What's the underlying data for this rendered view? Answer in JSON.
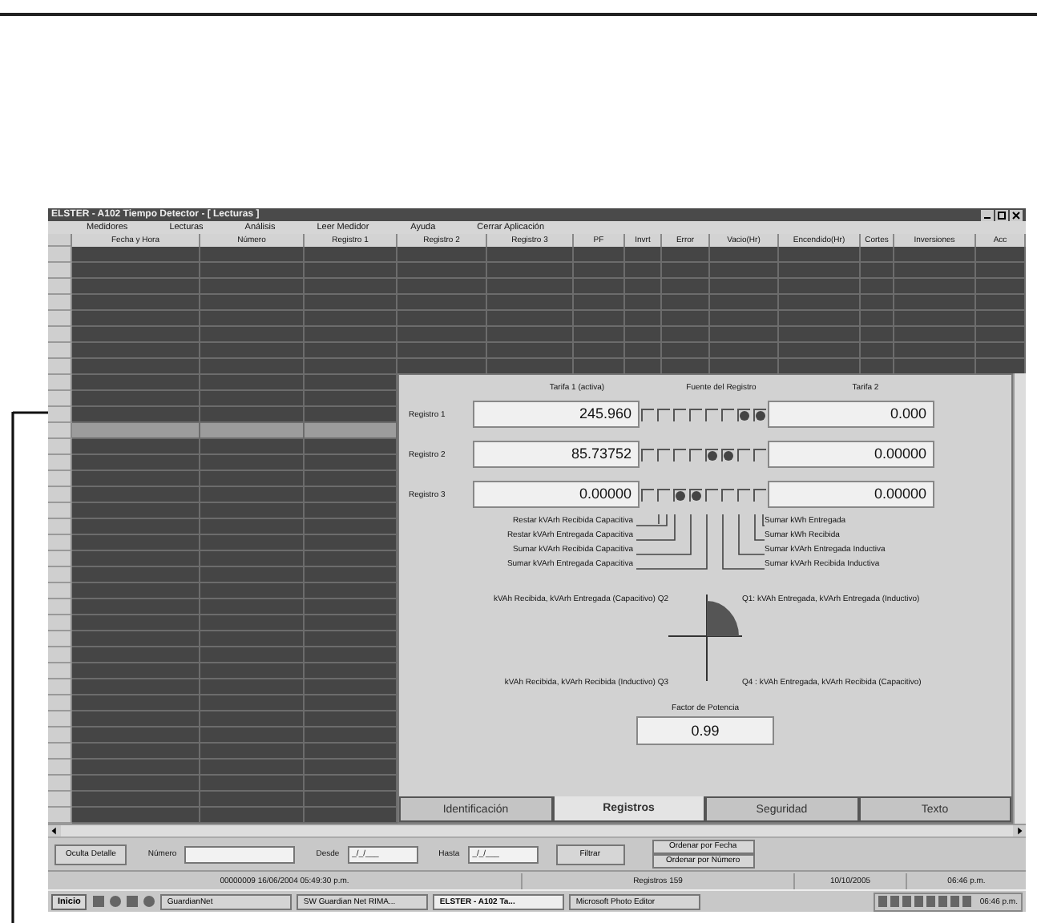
{
  "window": {
    "title": "ELSTER - A102 Tiempo Detector - [ Lecturas ]"
  },
  "menu": [
    "Medidores",
    "Lecturas",
    "Análisis",
    "Leer Medidor",
    "Ayuda",
    "Cerrar Aplicación"
  ],
  "table": {
    "columns": [
      "Fecha y Hora",
      "Número",
      "Registro 1",
      "Registro 2",
      "Registro 3",
      "PF",
      "Invrt",
      "Error",
      "Vacio(Hr)",
      "Encendido(Hr)",
      "Cortes",
      "Inversiones",
      "Acc"
    ],
    "rows": [
      {
        "selected": false
      },
      {
        "selected": false
      },
      {
        "selected": false
      },
      {
        "selected": false
      },
      {
        "selected": false
      },
      {
        "selected": false
      },
      {
        "selected": false
      },
      {
        "selected": false
      },
      {
        "selected": false
      },
      {
        "selected": false
      },
      {
        "selected": false
      },
      {
        "selected": true
      },
      {
        "selected": false
      },
      {
        "selected": false
      },
      {
        "selected": false
      },
      {
        "selected": false
      },
      {
        "selected": false
      },
      {
        "selected": false
      },
      {
        "selected": false
      },
      {
        "selected": false
      },
      {
        "selected": false
      },
      {
        "selected": false
      },
      {
        "selected": false
      },
      {
        "selected": false
      },
      {
        "selected": false
      },
      {
        "selected": false
      },
      {
        "selected": false
      },
      {
        "selected": false
      },
      {
        "selected": false
      },
      {
        "selected": false
      },
      {
        "selected": false
      },
      {
        "selected": false
      },
      {
        "selected": false
      },
      {
        "selected": false
      },
      {
        "selected": false
      },
      {
        "selected": false
      }
    ]
  },
  "detail_panel": {
    "tarifa_1_header": "Tarifa 1 (activa)",
    "source_header": "Fuente del Registro",
    "tarifa_2_header": "Tarifa 2",
    "registers": [
      {
        "label": "Registro 1",
        "tarifa_1": "245.960",
        "tarifa_2": "0.000",
        "sources": [
          false,
          false,
          false,
          false,
          false,
          false,
          true,
          true
        ]
      },
      {
        "label": "Registro 2",
        "tarifa_1": "85.73752",
        "tarifa_2": "0.00000",
        "sources": [
          false,
          false,
          false,
          false,
          true,
          true,
          false,
          false
        ]
      },
      {
        "label": "Registro 3",
        "tarifa_1": "0.00000",
        "tarifa_2": "0.00000",
        "sources": [
          false,
          false,
          true,
          true,
          false,
          false,
          false,
          false
        ]
      }
    ],
    "legend_left": [
      "Restar kVArh Recibida Capacitiva",
      "Restar kVArh Entregada Capacitiva",
      "Sumar kVArh Recibida Capacitiva",
      "Sumar kVArh Entregada Capacitiva"
    ],
    "legend_right": [
      "Sumar kWh Entregada",
      "Sumar kWh Recibida",
      "Sumar kVArh Entregada Inductiva",
      "Sumar kVArh Recibida Inductiva"
    ],
    "quadrants": {
      "q2": "kVAh Recibida, kVArh Entregada (Capacitivo)  Q2",
      "q1": "Q1: kVAh Entregada, kVArh Entregada (Inductivo)",
      "q3": "kVAh Recibida, kVArh Recibida (Inductivo)  Q3",
      "q4": "Q4 : kVAh Entregada, kVArh Recibida (Capacitivo)"
    },
    "power_factor": {
      "label": "Factor de Potencia",
      "value": "0.99"
    },
    "tabs": [
      {
        "label": "Identificación",
        "selected": false
      },
      {
        "label": "Registros",
        "selected": true
      },
      {
        "label": "Seguridad",
        "selected": false
      },
      {
        "label": "Texto",
        "selected": false
      }
    ]
  },
  "toolbar": {
    "hide_button": "Oculta Detalle",
    "numero": {
      "label": "Número"
    },
    "desde": {
      "label": "Desde",
      "value": "_/_/___"
    },
    "hasta": {
      "label": "Hasta",
      "value": "_/_/___"
    },
    "filter_button": "Filtrar",
    "sort_buttons": [
      "Ordenar por Fecha",
      "Ordenar por Número"
    ]
  },
  "status_bar": [
    "00000009 16/06/2004 05:49:30 p.m.",
    "Registros 159",
    "10/10/2005",
    "06:46 p.m."
  ],
  "taskbar": {
    "start": "Inicio",
    "tasks": [
      {
        "label": "GuardianNet",
        "selected": false
      },
      {
        "label": "SW Guardian Net RIMA...",
        "selected": false
      },
      {
        "label": "ELSTER - A102 Ta...",
        "selected": true
      },
      {
        "label": "Microsoft Photo Editor",
        "selected": false
      }
    ],
    "clock": "06:46 p.m."
  }
}
